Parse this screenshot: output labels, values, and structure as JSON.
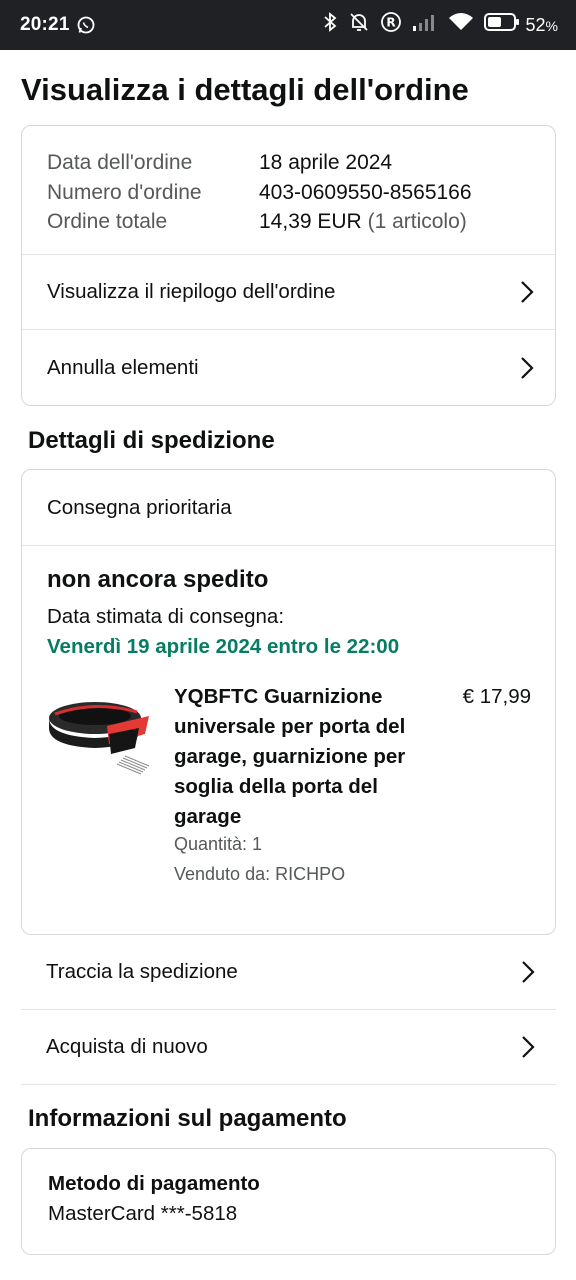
{
  "status_bar": {
    "time": "20:21",
    "battery": "52",
    "battery_suffix": "%"
  },
  "page": {
    "title": "Visualizza i dettagli dell'ordine"
  },
  "order": {
    "date_label": "Data dell'ordine",
    "date_value": "18 aprile 2024",
    "number_label": "Numero d'ordine",
    "number_value": "403-0609550-8565166",
    "total_label": "Ordine totale",
    "total_value": "14,39 EUR",
    "total_items": "(1 articolo)",
    "summary_link": "Visualizza il riepilogo dell'ordine",
    "cancel_link": "Annulla elementi"
  },
  "shipping": {
    "section_title": "Dettagli di spedizione",
    "delivery_type": "Consegna prioritaria",
    "status": "non ancora spedito",
    "estimate_label": "Data stimata di consegna:",
    "estimate_date": "Venerdì 19 aprile 2024 entro le 22:00",
    "product": {
      "title": "YQBFTC Guarnizione universale per porta del garage, guarnizione per soglia della porta del garage",
      "price": "€ 17,99",
      "quantity": "Quantità: 1",
      "seller": "Venduto da: RICHPO"
    },
    "track_link": "Traccia la spedizione",
    "buy_again_link": "Acquista di nuovo"
  },
  "payment": {
    "section_title": "Informazioni sul pagamento",
    "method_label": "Metodo di pagamento",
    "method_value": "MasterCard ***-5818"
  },
  "colors": {
    "delivery_green": "#067d62",
    "status_bar_bg": "#202124",
    "border": "#d5d9d9"
  }
}
